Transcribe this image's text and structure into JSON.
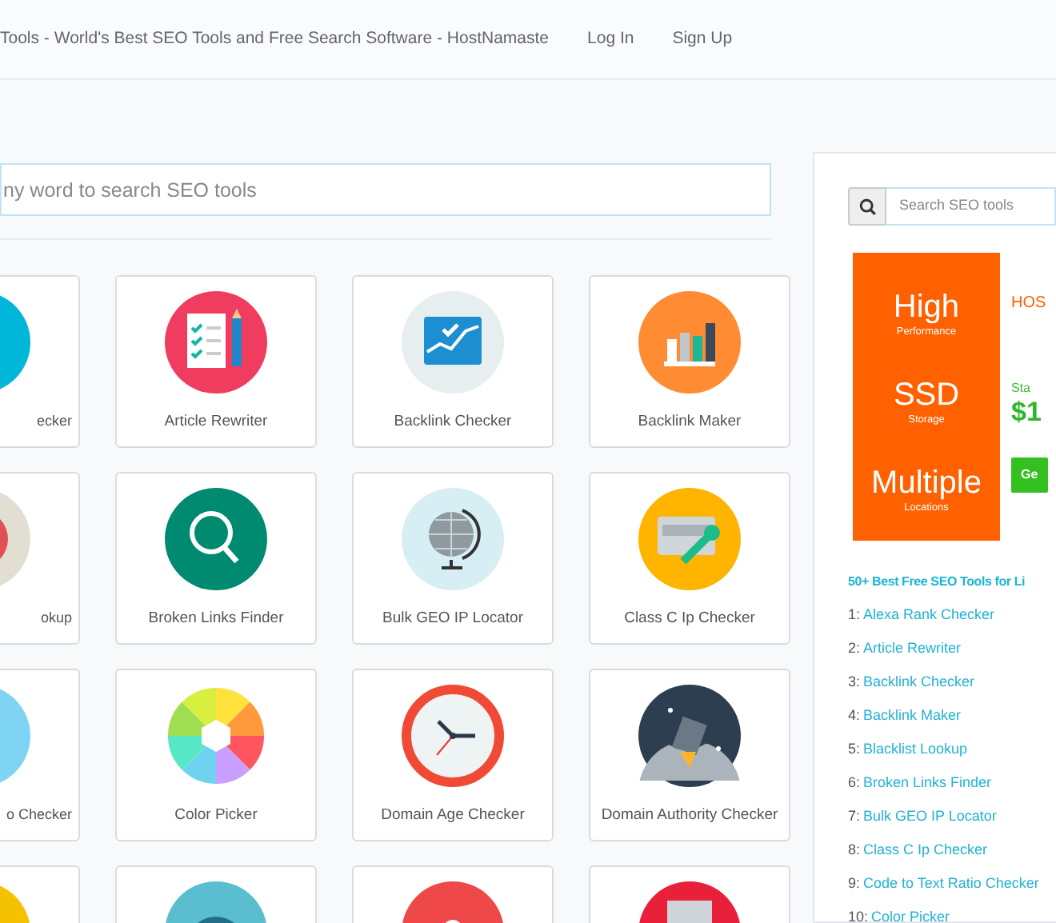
{
  "navbar": {
    "title": "Tools - World's Best SEO Tools and Free Search Software - HostNamaste",
    "links": [
      "Log In",
      "Sign Up"
    ]
  },
  "main_search": {
    "placeholder": "ny word to search SEO tools"
  },
  "tools": [
    {
      "kind": "labeled",
      "label": "ecker"
    },
    {
      "kind": "labeled",
      "label": "Article Rewriter"
    },
    {
      "kind": "labeled",
      "label": "Backlink Checker"
    },
    {
      "kind": "labeled",
      "label": "Backlink Maker"
    },
    {
      "kind": "labeled",
      "label": "okup"
    },
    {
      "kind": "labeled",
      "label": "Broken Links Finder"
    },
    {
      "kind": "labeled",
      "label": "Bulk GEO IP Locator"
    },
    {
      "kind": "labeled",
      "label": "Class C Ip Checker"
    },
    {
      "kind": "labeled",
      "label": "o Checker"
    },
    {
      "kind": "labeled",
      "label": "Color Picker"
    },
    {
      "kind": "labeled",
      "label": "Domain Age Checker"
    },
    {
      "kind": "labeled",
      "label": "Domain Authority Checker"
    },
    {
      "kind": "icon_only"
    },
    {
      "kind": "icon_only"
    },
    {
      "kind": "icon_only"
    },
    {
      "kind": "icon_only"
    }
  ],
  "sidebar": {
    "search": {
      "placeholder": "Search SEO tools"
    },
    "ad": {
      "features": [
        {
          "title": "High",
          "subtitle": "Performance"
        },
        {
          "title": "SSD",
          "subtitle": "Storage"
        },
        {
          "title": "Multiple",
          "subtitle": "Locations"
        }
      ],
      "brand": "HOS",
      "starting": "Sta",
      "price": "$1",
      "button": "Ge"
    },
    "list_title": "50+ Best Free SEO Tools for Li",
    "list": [
      {
        "number": "1:",
        "label": "Alexa Rank Checker"
      },
      {
        "number": "2:",
        "label": "Article Rewriter"
      },
      {
        "number": "3:",
        "label": "Backlink Checker"
      },
      {
        "number": "4:",
        "label": "Backlink Maker"
      },
      {
        "number": "5:",
        "label": "Blacklist Lookup"
      },
      {
        "number": "6:",
        "label": "Broken Links Finder"
      },
      {
        "number": "7:",
        "label": "Bulk GEO IP Locator"
      },
      {
        "number": "8:",
        "label": "Class C Ip Checker"
      },
      {
        "number": "9:",
        "label": "Code to Text Ratio Checker"
      },
      {
        "number": "10:",
        "label": "Color Picker"
      }
    ]
  }
}
